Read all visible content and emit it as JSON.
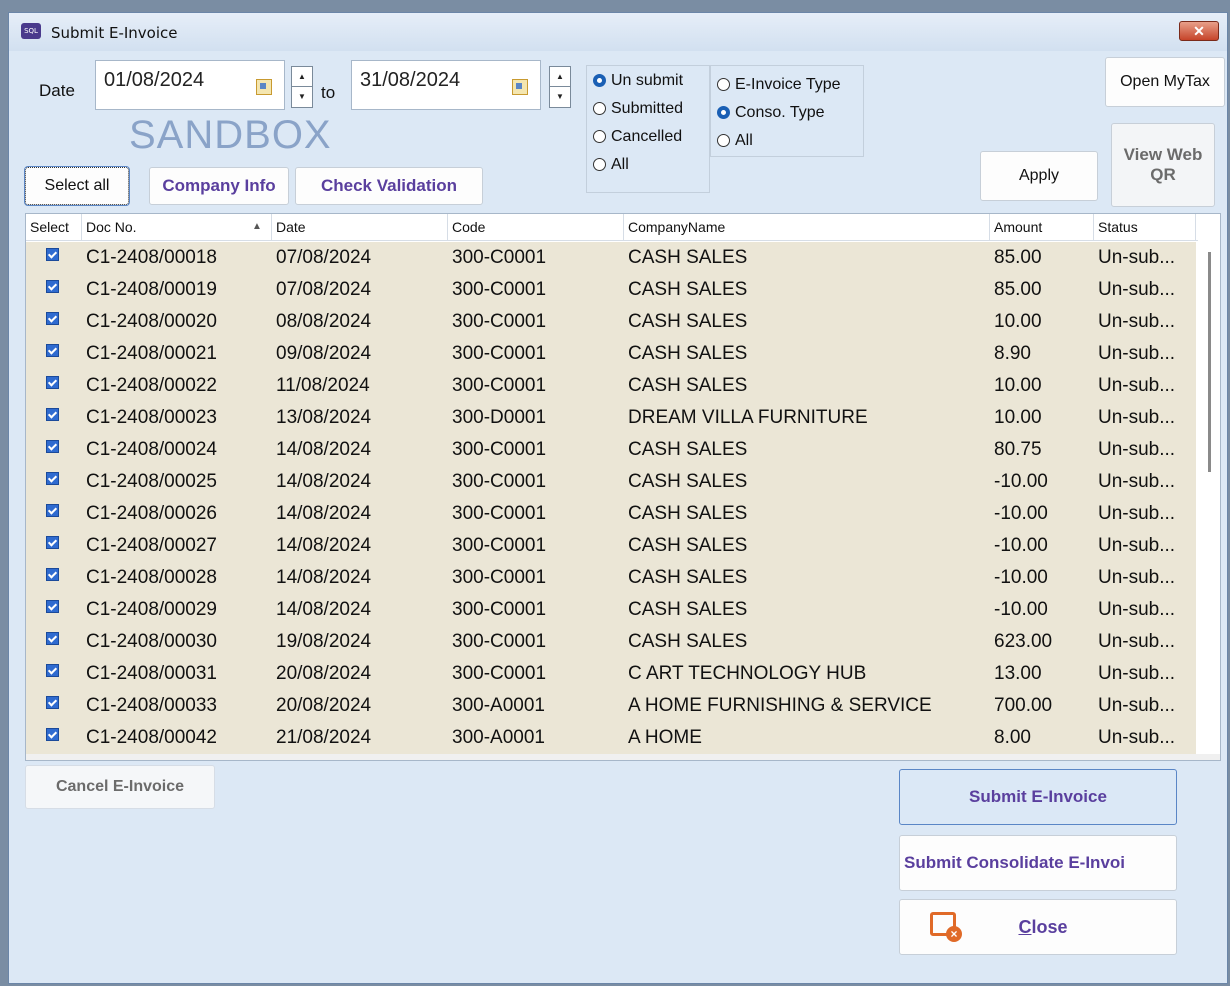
{
  "window": {
    "title": "Submit E-Invoice",
    "close_symbol": "✕",
    "app_icon_text": "SQL"
  },
  "filter": {
    "date_label": "Date",
    "date_from": "01/08/2024",
    "to_label": "to",
    "date_to": "31/08/2024",
    "environment": "SANDBOX"
  },
  "status_options": [
    {
      "label": "Un submit",
      "selected": true
    },
    {
      "label": "Submitted",
      "selected": false
    },
    {
      "label": "Cancelled",
      "selected": false
    },
    {
      "label": "All",
      "selected": false
    }
  ],
  "type_options": [
    {
      "label": "E-Invoice Type",
      "selected": false
    },
    {
      "label": "Conso. Type",
      "selected": true
    },
    {
      "label": "All",
      "selected": false
    }
  ],
  "buttons": {
    "select_all": "Select all",
    "company_info": "Company Info",
    "check_validation": "Check Validation",
    "open_mytax": "Open MyTax",
    "apply": "Apply",
    "view_web_qr_line1": "View Web",
    "view_web_qr_line2": "QR",
    "cancel_einvoice": "Cancel E-Invoice",
    "submit_einvoice": "Submit E-Invoice",
    "submit_consolidate": "Submit Consolidate E-Invoi",
    "close_accel": "C",
    "close_rest": "lose"
  },
  "grid": {
    "columns": [
      "Select",
      "Doc No.",
      "Date",
      "Code",
      "CompanyName",
      "Amount",
      "Status"
    ],
    "sort_indicator": "▲",
    "rows": [
      {
        "selected": true,
        "doc_no": "C1-2408/00018",
        "date": "07/08/2024",
        "code": "300-C0001",
        "company": "CASH SALES",
        "amount": "85.00",
        "status": "Un-sub..."
      },
      {
        "selected": true,
        "doc_no": "C1-2408/00019",
        "date": "07/08/2024",
        "code": "300-C0001",
        "company": "CASH SALES",
        "amount": "85.00",
        "status": "Un-sub..."
      },
      {
        "selected": true,
        "doc_no": "C1-2408/00020",
        "date": "08/08/2024",
        "code": "300-C0001",
        "company": "CASH SALES",
        "amount": "10.00",
        "status": "Un-sub..."
      },
      {
        "selected": true,
        "doc_no": "C1-2408/00021",
        "date": "09/08/2024",
        "code": "300-C0001",
        "company": "CASH SALES",
        "amount": "8.90",
        "status": "Un-sub..."
      },
      {
        "selected": true,
        "doc_no": "C1-2408/00022",
        "date": "11/08/2024",
        "code": "300-C0001",
        "company": "CASH SALES",
        "amount": "10.00",
        "status": "Un-sub..."
      },
      {
        "selected": true,
        "doc_no": "C1-2408/00023",
        "date": "13/08/2024",
        "code": "300-D0001",
        "company": "DREAM VILLA FURNITURE",
        "amount": "10.00",
        "status": "Un-sub..."
      },
      {
        "selected": true,
        "doc_no": "C1-2408/00024",
        "date": "14/08/2024",
        "code": "300-C0001",
        "company": "CASH SALES",
        "amount": "80.75",
        "status": "Un-sub..."
      },
      {
        "selected": true,
        "doc_no": "C1-2408/00025",
        "date": "14/08/2024",
        "code": "300-C0001",
        "company": "CASH SALES",
        "amount": "-10.00",
        "status": "Un-sub..."
      },
      {
        "selected": true,
        "doc_no": "C1-2408/00026",
        "date": "14/08/2024",
        "code": "300-C0001",
        "company": "CASH SALES",
        "amount": "-10.00",
        "status": "Un-sub..."
      },
      {
        "selected": true,
        "doc_no": "C1-2408/00027",
        "date": "14/08/2024",
        "code": "300-C0001",
        "company": "CASH SALES",
        "amount": "-10.00",
        "status": "Un-sub..."
      },
      {
        "selected": true,
        "doc_no": "C1-2408/00028",
        "date": "14/08/2024",
        "code": "300-C0001",
        "company": "CASH SALES",
        "amount": "-10.00",
        "status": "Un-sub..."
      },
      {
        "selected": true,
        "doc_no": "C1-2408/00029",
        "date": "14/08/2024",
        "code": "300-C0001",
        "company": "CASH SALES",
        "amount": "-10.00",
        "status": "Un-sub..."
      },
      {
        "selected": true,
        "doc_no": "C1-2408/00030",
        "date": "19/08/2024",
        "code": "300-C0001",
        "company": "CASH SALES",
        "amount": "623.00",
        "status": "Un-sub..."
      },
      {
        "selected": true,
        "doc_no": "C1-2408/00031",
        "date": "20/08/2024",
        "code": "300-C0001",
        "company": "C ART TECHNOLOGY HUB",
        "amount": "13.00",
        "status": "Un-sub..."
      },
      {
        "selected": true,
        "doc_no": "C1-2408/00033",
        "date": "20/08/2024",
        "code": "300-A0001",
        "company": "A HOME FURNISHING & SERVICE",
        "amount": "700.00",
        "status": "Un-sub..."
      },
      {
        "selected": true,
        "doc_no": "C1-2408/00042",
        "date": "21/08/2024",
        "code": "300-A0001",
        "company": "A HOME",
        "amount": "8.00",
        "status": "Un-sub..."
      }
    ]
  },
  "colors": {
    "window_bg": "#dce8f5",
    "row_bg": "#ebe6d6",
    "accent_purple": "#5a3f9e",
    "radio_selected": "#1a5fb4",
    "close_orange": "#e06a28"
  }
}
